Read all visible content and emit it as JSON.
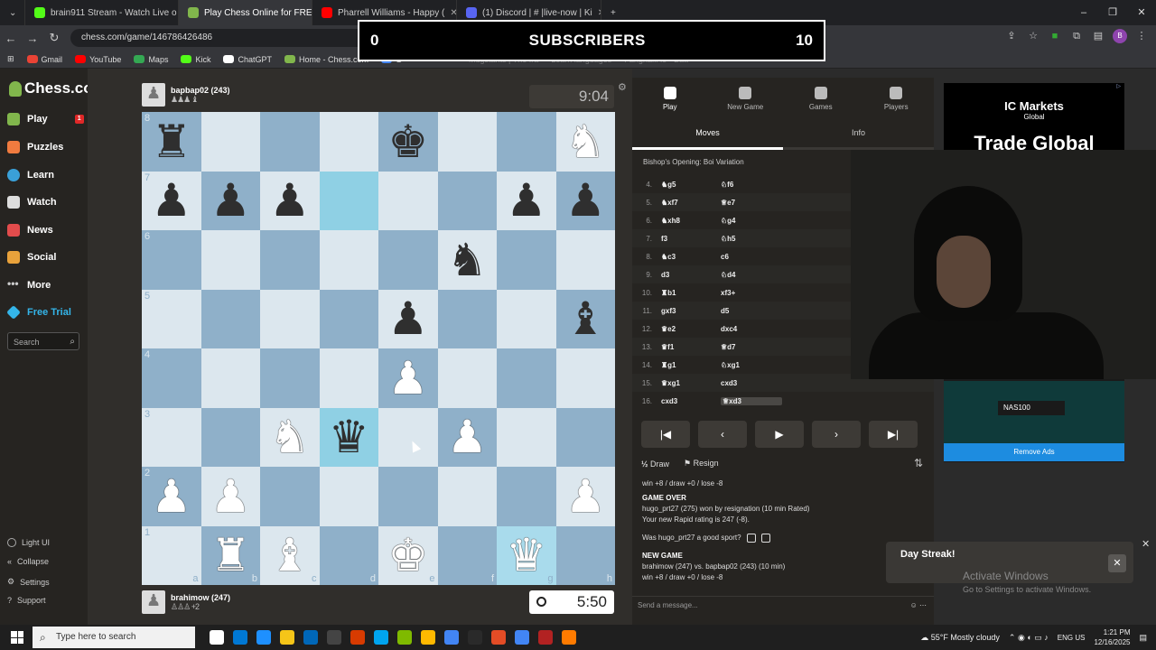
{
  "browser": {
    "tabs": [
      {
        "title": "brain911 Stream - Watch Live o",
        "color": "#53fc18",
        "active": false
      },
      {
        "title": "Play Chess Online for FREE - 2",
        "color": "#81b64c",
        "active": true
      },
      {
        "title": "Pharrell Williams - Happy (",
        "color": "#ff0000",
        "active": false
      },
      {
        "title": "(1) Discord | # |live-now | Ki",
        "color": "#5865f2",
        "active": false
      }
    ],
    "url": "chess.com/game/146786426486",
    "bookmarks": [
      {
        "label": "Gmail",
        "color": "#ea4335"
      },
      {
        "label": "YouTube",
        "color": "#ff0000"
      },
      {
        "label": "Maps",
        "color": "#34a853"
      },
      {
        "label": "Kick",
        "color": "#53fc18"
      },
      {
        "label": "ChatGPT",
        "color": "#ffffff"
      },
      {
        "label": "Home - Chess.com",
        "color": "#81b64c"
      },
      {
        "label": "G",
        "color": "#4285f4"
      }
    ],
    "faint_bookmarks": [
      "Mugstants | The Ira",
      "Learn languages",
      "Fanghaffl io - Batt"
    ]
  },
  "overlay": {
    "left_count": "0",
    "label": "SUBSCRIBERS",
    "right_count": "10"
  },
  "sidebar": {
    "logo": "Chess.com",
    "logo_badge": "11",
    "items": [
      {
        "label": "Play",
        "color": "#81b64c",
        "badge": "1"
      },
      {
        "label": "Puzzles",
        "color": "#f07b3f"
      },
      {
        "label": "Learn",
        "color": "#3aa0d8"
      },
      {
        "label": "Watch",
        "color": "#ffffff"
      },
      {
        "label": "News",
        "color": "#e24c4c"
      },
      {
        "label": "Social",
        "color": "#e9a23b"
      },
      {
        "label": "More",
        "color": "#cccccc"
      },
      {
        "label": "Free Trial",
        "color": "#34b5e9"
      }
    ],
    "search_placeholder": "Search",
    "bottom": [
      "Light UI",
      "Collapse",
      "Settings",
      "Support"
    ]
  },
  "game": {
    "top_player": {
      "name": "bapbap02 (243)",
      "captured": "♟♟♟ ♝"
    },
    "bottom_player": {
      "name": "brahimow (247)",
      "captured": "♙♙♙ +2"
    },
    "top_clock": "9:04",
    "bottom_clock": "5:50",
    "files": [
      "a",
      "b",
      "c",
      "d",
      "e",
      "f",
      "g",
      "h"
    ],
    "highlight_squares": [
      "d7",
      "d3",
      "g1"
    ],
    "position": {
      "a8": "br",
      "e8": "bk",
      "h8": "wn",
      "a7": "bp",
      "b7": "bp",
      "c7": "bp",
      "g7": "bp",
      "h7": "bp",
      "f6": "bn",
      "e5": "bp",
      "h5": "bb",
      "e4": "wp",
      "c3": "wn",
      "d3": "bq",
      "f3": "wp",
      "a2": "wp",
      "b2": "wp",
      "h2": "wp",
      "b1": "wr",
      "c1": "wb",
      "e1": "wk",
      "g1": "wq"
    }
  },
  "panel": {
    "tabs": [
      "Play",
      "New Game",
      "Games",
      "Players"
    ],
    "subtabs": [
      "Moves",
      "Info"
    ],
    "opening": "Bishop's Opening: Boi Variation",
    "moves": [
      {
        "n": "4.",
        "w": "♞g5",
        "b": "♘f6"
      },
      {
        "n": "5.",
        "w": "♞xf7",
        "b": "♕e7"
      },
      {
        "n": "6.",
        "w": "♞xh8",
        "b": "♘g4"
      },
      {
        "n": "7.",
        "w": "f3",
        "b": "♘h5"
      },
      {
        "n": "8.",
        "w": "♞c3",
        "b": "c6"
      },
      {
        "n": "9.",
        "w": "d3",
        "b": "♘d4"
      },
      {
        "n": "10.",
        "w": "♜b1",
        "b": "xf3+"
      },
      {
        "n": "11.",
        "w": "gxf3",
        "b": "d5"
      },
      {
        "n": "12.",
        "w": "♛e2",
        "b": "dxc4"
      },
      {
        "n": "13.",
        "w": "♛f1",
        "b": "♕d7"
      },
      {
        "n": "14.",
        "w": "♜g1",
        "b": "♘xg1"
      },
      {
        "n": "15.",
        "w": "♛xg1",
        "b": "cxd3"
      },
      {
        "n": "16.",
        "w": "cxd3",
        "b": "♕xd3"
      }
    ],
    "nav_buttons": [
      "|◀",
      "◀",
      "▶",
      "▶",
      "▶|"
    ],
    "draw_label": "Draw",
    "resign_label": "Resign",
    "log_line1": "win +8 / draw +0 / lose -8",
    "log_game_over": "GAME OVER",
    "log_result": "hugo_prt27 (275) won by resignation (10 min Rated)",
    "log_rating": "Your new Rapid rating is 247 (-8).",
    "log_sport": "Was hugo_prt27 a good sport?",
    "log_new_game": "NEW GAME",
    "log_match": "brahimow (247) vs. bapbap02 (243) (10 min)",
    "log_line2": "win +8 / draw +0 / lose -8",
    "message_placeholder": "Send a message..."
  },
  "ad": {
    "brand": "IC Markets",
    "brand_sub": "Global",
    "headline": "Trade Global",
    "ticker": "NAS100",
    "remove": "Remove Ads"
  },
  "toast": {
    "title": "Day Streak!"
  },
  "watermark": {
    "line1": "Activate Windows",
    "line2": "Go to Settings to activate Windows."
  },
  "taskbar": {
    "search": "Type here to search",
    "weather": "55°F Mostly cloudy",
    "lang": "ENG US",
    "time": "1:21 PM",
    "date": "12/16/2025",
    "apps": [
      "#ffffff",
      "#0078d4",
      "#1e90ff",
      "#f5c518",
      "#0067b8",
      "#444444",
      "#d83b01",
      "#00a4ef",
      "#7fba00",
      "#ffb900",
      "#4285f4",
      "#2a2a2a",
      "#e34c26",
      "#4285f4",
      "#b22222",
      "#ff7b00"
    ]
  }
}
